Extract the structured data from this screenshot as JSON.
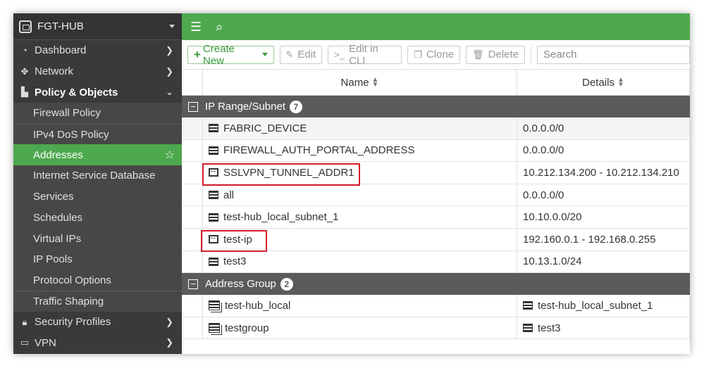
{
  "device": {
    "name": "FGT-HUB"
  },
  "sidebar": {
    "items": [
      {
        "label": "Dashboard",
        "icon": "dashboard-icon"
      },
      {
        "label": "Network",
        "icon": "network-icon"
      },
      {
        "label": "Policy & Objects",
        "icon": "policy-icon"
      }
    ],
    "sub_items": [
      {
        "label": "Firewall Policy"
      },
      {
        "label": "IPv4 DoS Policy"
      },
      {
        "label": "Addresses"
      },
      {
        "label": "Internet Service Database"
      },
      {
        "label": "Services"
      },
      {
        "label": "Schedules"
      },
      {
        "label": "Virtual IPs"
      },
      {
        "label": "IP Pools"
      },
      {
        "label": "Protocol Options"
      },
      {
        "label": "Traffic Shaping"
      }
    ],
    "bottom_items": [
      {
        "label": "Security Profiles",
        "icon": "security-profiles-icon"
      },
      {
        "label": "VPN",
        "icon": "vpn-icon"
      }
    ]
  },
  "toolbar": {
    "create_label": "Create New",
    "edit_label": "Edit",
    "edit_cli_label": "Edit in CLI",
    "clone_label": "Clone",
    "delete_label": "Delete",
    "search_placeholder": "Search"
  },
  "table": {
    "columns": [
      "Name",
      "Details"
    ],
    "groups": [
      {
        "label": "IP Range/Subnet",
        "count": "7",
        "rows": [
          {
            "name": "FABRIC_DEVICE",
            "details": "0.0.0.0/0",
            "icon": "subnet"
          },
          {
            "name": "FIREWALL_AUTH_PORTAL_ADDRESS",
            "details": "0.0.0.0/0",
            "icon": "subnet"
          },
          {
            "name": "SSLVPN_TUNNEL_ADDR1",
            "details": "10.212.134.200 - 10.212.134.210",
            "icon": "range"
          },
          {
            "name": "all",
            "details": "0.0.0.0/0",
            "icon": "subnet"
          },
          {
            "name": "test-hub_local_subnet_1",
            "details": "10.10.0.0/20",
            "icon": "subnet"
          },
          {
            "name": "test-ip",
            "details": "192.160.0.1 - 192.168.0.255",
            "icon": "range"
          },
          {
            "name": "test3",
            "details": "10.13.1.0/24",
            "icon": "subnet"
          }
        ]
      },
      {
        "label": "Address Group",
        "count": "2",
        "rows": [
          {
            "name": "test-hub_local",
            "details": "test-hub_local_subnet_1",
            "icon": "group"
          },
          {
            "name": "testgroup",
            "details": "test3",
            "icon": "group"
          }
        ]
      }
    ]
  },
  "colors": {
    "accent": "#4ea84e",
    "sidebar_bg": "#3a3a3a",
    "group_header_bg": "#5b5b5b",
    "highlight": "#d81e2a"
  }
}
